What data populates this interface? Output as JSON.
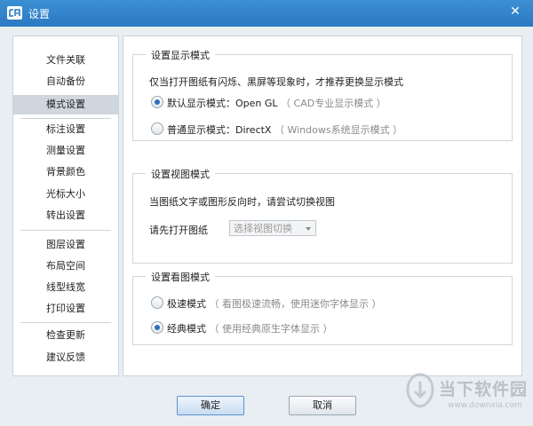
{
  "window": {
    "title": "设置",
    "close_glyph": "✕",
    "app_icon": "cad-app-icon"
  },
  "sidebar": {
    "items": [
      {
        "label": "文件关联",
        "active": false
      },
      {
        "label": "自动备份",
        "active": false
      },
      {
        "label": "模式设置",
        "active": true
      },
      {
        "label": "标注设置",
        "active": false
      },
      {
        "label": "测量设置",
        "active": false
      },
      {
        "label": "背景颜色",
        "active": false
      },
      {
        "label": "光标大小",
        "active": false
      },
      {
        "label": "转出设置",
        "active": false
      },
      {
        "label": "图层设置",
        "active": false
      },
      {
        "label": "布局空间",
        "active": false
      },
      {
        "label": "线型线宽",
        "active": false
      },
      {
        "label": "打印设置",
        "active": false
      },
      {
        "label": "检查更新",
        "active": false
      },
      {
        "label": "建议反馈",
        "active": false
      }
    ]
  },
  "display_mode": {
    "title": "设置显示模式",
    "description": "仅当打开图纸有闪烁、黑屏等现象时，才推荐更换显示模式",
    "options": [
      {
        "label": "默认显示模式：Open GL",
        "hint": "（ CAD专业显示模式 ）",
        "checked": true
      },
      {
        "label": "普通显示模式：DirectX",
        "hint": "（ Windows系统显示模式 ）",
        "checked": false
      }
    ]
  },
  "view_mode": {
    "title": "设置视图模式",
    "description": "当图纸文字或图形反向时，请尝试切换视图",
    "open_label": "请先打开图纸",
    "select_placeholder": "选择视图切换"
  },
  "read_mode": {
    "title": "设置看图模式",
    "options": [
      {
        "label": "极速模式",
        "hint": "（ 看图极速流畅，使用迷你字体显示 ）",
        "checked": false
      },
      {
        "label": "经典模式",
        "hint": "（ 使用经典原生字体显示 ）",
        "checked": true
      }
    ]
  },
  "buttons": {
    "ok": "确定",
    "cancel": "取消"
  },
  "watermark": {
    "name": "当下软件园",
    "url": "www.downxia.com"
  },
  "colors": {
    "titlebar": "#2b79c2",
    "accent": "#2f6fc2",
    "active_item": "#cfd6dd"
  }
}
